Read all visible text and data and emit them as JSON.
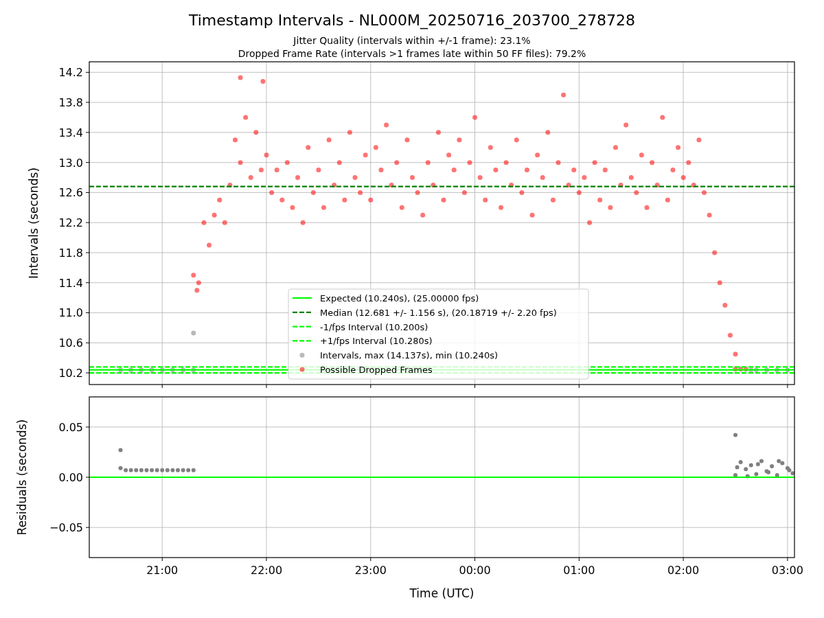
{
  "figure": {
    "title": "Timestamp Intervals - NL000M_20250716_203700_278728",
    "subtitles": [
      "Jitter Quality (intervals within +/-1 frame): 23.1%",
      "Dropped Frame Rate (intervals >1 frames late within 50 FF files): 79.2%"
    ]
  },
  "charts": [
    {
      "chart_data": {
        "type": "scatter",
        "ylabel": "Intervals (seconds)",
        "xlim": [
          "2025-07-16T20:18",
          "2025-07-17T03:04"
        ],
        "ylim": [
          10.045,
          14.34
        ],
        "grid": true,
        "legend": true,
        "yticks": [
          {
            "value": 10.2,
            "label": "10.2"
          },
          {
            "value": 10.6,
            "label": "10.6"
          },
          {
            "value": 11.0,
            "label": "11.0"
          },
          {
            "value": 11.4,
            "label": "11.4"
          },
          {
            "value": 11.8,
            "label": "11.8"
          },
          {
            "value": 12.2,
            "label": "12.2"
          },
          {
            "value": 12.6,
            "label": "12.6"
          },
          {
            "value": 13.0,
            "label": "13.0"
          },
          {
            "value": 13.4,
            "label": "13.4"
          },
          {
            "value": 13.8,
            "label": "13.8"
          },
          {
            "value": 14.2,
            "label": "14.2"
          }
        ],
        "ref_lines": [
          {
            "axis": "y",
            "value": 10.24,
            "label": "Expected (10.240s), (25.00000 fps)",
            "color": "#00ff00"
          },
          {
            "axis": "y",
            "value": 12.681,
            "label": "Median (12.681 +/- 1.156 s), (20.18719 +/- 2.20 fps)",
            "color": "#008000"
          },
          {
            "axis": "y",
            "value": 10.2,
            "label": "-1/fps Interval (10.200s)",
            "color": "#00ff00"
          },
          {
            "axis": "y",
            "value": 10.28,
            "label": "+1/fps Interval (10.280s)",
            "color": "#00ff00"
          }
        ],
        "series": [
          {
            "name": "Intervals, max (14.137s), min (10.240s)",
            "color": "#808080",
            "x": [
              "2025-07-16T20:36",
              "2025-07-16T20:42",
              "2025-07-16T20:48",
              "2025-07-16T20:54",
              "2025-07-16T21:00",
              "2025-07-16T21:06",
              "2025-07-16T21:12",
              "2025-07-16T21:18",
              "2025-07-16T21:18",
              "2025-07-17T02:39",
              "2025-07-17T02:42",
              "2025-07-17T02:48",
              "2025-07-17T02:54",
              "2025-07-17T03:00"
            ],
            "values": [
              10.24,
              10.24,
              10.24,
              10.24,
              10.24,
              10.24,
              10.24,
              10.24,
              10.73,
              10.24,
              10.24,
              10.24,
              10.24,
              10.24
            ]
          },
          {
            "name": "Possible Dropped Frames",
            "color": "#ff0000",
            "x": [
              "2025-07-16T21:18",
              "2025-07-16T21:21",
              "2025-07-16T21:24",
              "2025-07-16T21:27",
              "2025-07-16T21:30",
              "2025-07-16T21:33",
              "2025-07-16T21:36",
              "2025-07-16T21:39",
              "2025-07-16T21:42",
              "2025-07-16T21:45",
              "2025-07-16T21:48",
              "2025-07-16T21:51",
              "2025-07-16T21:54",
              "2025-07-16T21:57",
              "2025-07-16T22:00",
              "2025-07-16T22:03",
              "2025-07-16T22:06",
              "2025-07-16T22:09",
              "2025-07-16T22:12",
              "2025-07-16T22:15",
              "2025-07-16T22:18",
              "2025-07-16T22:21",
              "2025-07-16T22:24",
              "2025-07-16T22:27",
              "2025-07-16T22:30",
              "2025-07-16T22:33",
              "2025-07-16T22:36",
              "2025-07-16T22:39",
              "2025-07-16T22:42",
              "2025-07-16T22:45",
              "2025-07-16T22:48",
              "2025-07-16T22:51",
              "2025-07-16T22:54",
              "2025-07-16T22:57",
              "2025-07-16T23:00",
              "2025-07-16T23:03",
              "2025-07-16T23:06",
              "2025-07-16T23:09",
              "2025-07-16T23:12",
              "2025-07-16T23:15",
              "2025-07-16T23:18",
              "2025-07-16T23:21",
              "2025-07-16T23:24",
              "2025-07-16T23:27",
              "2025-07-16T23:30",
              "2025-07-16T23:33",
              "2025-07-16T23:36",
              "2025-07-16T23:39",
              "2025-07-16T23:42",
              "2025-07-16T23:45",
              "2025-07-16T23:48",
              "2025-07-16T23:51",
              "2025-07-16T23:54",
              "2025-07-16T23:57",
              "2025-07-17T00:00",
              "2025-07-17T00:03",
              "2025-07-17T00:06",
              "2025-07-17T00:09",
              "2025-07-17T00:12",
              "2025-07-17T00:15",
              "2025-07-17T00:18",
              "2025-07-17T00:21",
              "2025-07-17T00:24",
              "2025-07-17T00:27",
              "2025-07-17T00:30",
              "2025-07-17T00:33",
              "2025-07-17T00:36",
              "2025-07-17T00:39",
              "2025-07-17T00:42",
              "2025-07-17T00:45",
              "2025-07-17T00:48",
              "2025-07-17T00:51",
              "2025-07-17T00:54",
              "2025-07-17T00:57",
              "2025-07-17T01:00",
              "2025-07-17T01:03",
              "2025-07-17T01:06",
              "2025-07-17T01:09",
              "2025-07-17T01:12",
              "2025-07-17T01:15",
              "2025-07-17T01:18",
              "2025-07-17T01:21",
              "2025-07-17T01:24",
              "2025-07-17T01:27",
              "2025-07-17T01:30",
              "2025-07-17T01:33",
              "2025-07-17T01:36",
              "2025-07-17T01:39",
              "2025-07-17T01:42",
              "2025-07-17T01:45",
              "2025-07-17T01:48",
              "2025-07-17T01:51",
              "2025-07-17T01:54",
              "2025-07-17T01:57",
              "2025-07-17T02:00",
              "2025-07-17T02:03",
              "2025-07-17T02:06",
              "2025-07-17T02:09",
              "2025-07-17T02:12",
              "2025-07-17T02:15",
              "2025-07-17T02:18",
              "2025-07-17T02:21",
              "2025-07-17T02:24",
              "2025-07-17T02:27",
              "2025-07-17T02:30",
              "2025-07-17T02:33",
              "2025-07-17T02:36",
              "2025-07-16T21:45",
              "2025-07-16T21:58",
              "2025-07-16T21:20",
              "2025-07-17T02:30"
            ],
            "values": [
              11.5,
              11.4,
              12.2,
              11.9,
              12.3,
              12.5,
              12.2,
              12.7,
              13.3,
              13.0,
              13.6,
              12.8,
              13.4,
              12.9,
              13.1,
              12.6,
              12.9,
              12.5,
              13.0,
              12.4,
              12.8,
              12.2,
              13.2,
              12.6,
              12.9,
              12.4,
              13.3,
              12.7,
              13.0,
              12.5,
              13.4,
              12.8,
              12.6,
              13.1,
              12.5,
              13.2,
              12.9,
              13.5,
              12.7,
              13.0,
              12.4,
              13.3,
              12.8,
              12.6,
              12.3,
              13.0,
              12.7,
              13.4,
              12.5,
              13.1,
              12.9,
              13.3,
              12.6,
              13.0,
              13.6,
              12.8,
              12.5,
              13.2,
              12.9,
              12.4,
              13.0,
              12.7,
              13.3,
              12.6,
              12.9,
              12.3,
              13.1,
              12.8,
              13.4,
              12.5,
              13.0,
              13.9,
              12.7,
              12.9,
              12.6,
              12.8,
              12.2,
              13.0,
              12.5,
              12.9,
              12.4,
              13.2,
              12.7,
              13.5,
              12.8,
              12.6,
              13.1,
              12.4,
              13.0,
              12.7,
              13.6,
              12.5,
              12.9,
              13.2,
              12.8,
              13.0,
              12.7,
              13.3,
              12.6,
              12.3,
              11.8,
              11.4,
              11.1,
              10.7,
              10.25,
              10.25,
              10.25,
              14.13,
              14.08,
              11.3,
              10.45
            ]
          }
        ]
      }
    },
    {
      "chart_data": {
        "type": "scatter",
        "xlabel": "Time (UTC)",
        "ylabel": "Residuals (seconds)",
        "xlim": [
          "2025-07-16T20:18",
          "2025-07-17T03:04"
        ],
        "ylim": [
          -0.08,
          0.08
        ],
        "grid": true,
        "xticks": [
          {
            "value": "2025-07-16T21:00",
            "label": "21:00"
          },
          {
            "value": "2025-07-16T22:00",
            "label": "22:00"
          },
          {
            "value": "2025-07-16T23:00",
            "label": "23:00"
          },
          {
            "value": "2025-07-17T00:00",
            "label": "00:00"
          },
          {
            "value": "2025-07-17T01:00",
            "label": "01:00"
          },
          {
            "value": "2025-07-17T02:00",
            "label": "02:00"
          },
          {
            "value": "2025-07-17T03:00",
            "label": "03:00"
          }
        ],
        "yticks": [
          {
            "value": -0.05,
            "label": "−0.05"
          },
          {
            "value": 0,
            "label": "0.00"
          },
          {
            "value": 0.05,
            "label": "0.05"
          }
        ],
        "ref_lines": [
          {
            "axis": "y",
            "value": 0,
            "color": "#00ff00"
          }
        ],
        "series": [
          {
            "color": "#808080",
            "x": [
              "2025-07-16T20:36",
              "2025-07-16T20:36",
              "2025-07-16T20:39",
              "2025-07-16T20:42",
              "2025-07-16T20:45",
              "2025-07-16T20:48",
              "2025-07-16T20:51",
              "2025-07-16T20:54",
              "2025-07-16T20:57",
              "2025-07-16T21:00",
              "2025-07-16T21:03",
              "2025-07-16T21:06",
              "2025-07-16T21:09",
              "2025-07-16T21:12",
              "2025-07-16T21:15",
              "2025-07-16T21:18",
              "2025-07-17T02:30",
              "2025-07-17T02:30",
              "2025-07-17T02:33",
              "2025-07-17T02:36",
              "2025-07-17T02:39",
              "2025-07-17T02:42",
              "2025-07-17T02:45",
              "2025-07-17T02:48",
              "2025-07-17T02:51",
              "2025-07-17T02:54",
              "2025-07-17T02:57",
              "2025-07-17T03:00",
              "2025-07-17T03:03",
              "2025-07-17T02:31",
              "2025-07-17T02:37",
              "2025-07-17T02:43",
              "2025-07-17T02:49",
              "2025-07-17T02:55",
              "2025-07-17T03:01"
            ],
            "values": [
              0.027,
              0.009,
              0.007,
              0.007,
              0.007,
              0.007,
              0.007,
              0.007,
              0.007,
              0.007,
              0.007,
              0.007,
              0.007,
              0.007,
              0.007,
              0.007,
              0.042,
              0.002,
              0.015,
              0.008,
              0.012,
              0.003,
              0.016,
              0.006,
              0.011,
              0.002,
              0.014,
              0.009,
              0.004,
              0.01,
              0.001,
              0.013,
              0.005,
              0.016,
              0.007
            ]
          }
        ]
      }
    }
  ]
}
